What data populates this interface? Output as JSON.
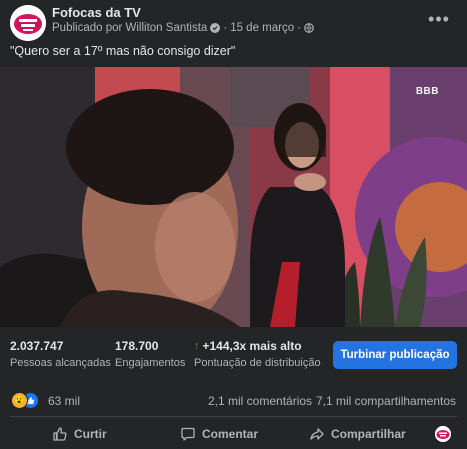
{
  "post": {
    "page_name": "Fofocas da TV",
    "published_by": "Publicado por Williton Santista",
    "separator": "·",
    "date": "15 de março",
    "caption": "\"Quero ser a 17º mas não consigo dizer\""
  },
  "media": {
    "channel_logo": "BBB"
  },
  "insights": {
    "reach_value": "2.037.747",
    "reach_label": "Pessoas alcançadas",
    "engagement_value": "178.700",
    "engagement_label": "Engajamentos",
    "distribution_value": "+144,3x mais alto",
    "distribution_label": "Pontuação de distribuição",
    "boost_label": "Turbinar publicação"
  },
  "reactions": {
    "count": "63 mil",
    "comments": "2,1 mil comentários",
    "shares": "7,1 mil compartilhamentos"
  },
  "actions": {
    "like": "Curtir",
    "comment": "Comentar",
    "share": "Compartilhar"
  },
  "colors": {
    "background": "#242526",
    "primary_text": "#e4e6eb",
    "secondary_text": "#b0b3b8",
    "accent": "#2374e1",
    "positive": "#31a24c"
  }
}
